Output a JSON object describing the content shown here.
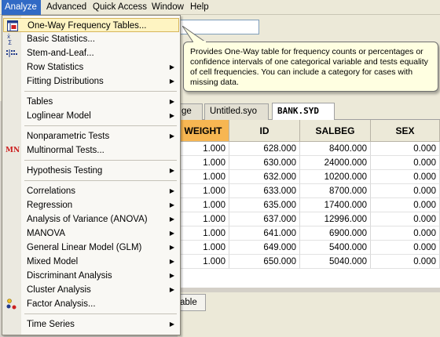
{
  "menubar": {
    "items": [
      "Analyze",
      "Advanced",
      "Quick Access",
      "Window",
      "Help"
    ]
  },
  "tooltip": {
    "text": "Provides One-Way table for frequency counts or percentages or confidence intervals of one categorical variable and tests equality of cell frequencies. You can include a category for cases with missing data."
  },
  "tabs": {
    "partial": "ge",
    "syntax": "Untitled.syo",
    "data": "BANK.SYD"
  },
  "grid": {
    "columns": [
      "WEIGHT",
      "ID",
      "SALBEG",
      "SEX"
    ],
    "rows": [
      [
        "1.000",
        "628.000",
        "8400.000",
        "0.000"
      ],
      [
        "1.000",
        "630.000",
        "24000.000",
        "0.000"
      ],
      [
        "1.000",
        "632.000",
        "10200.000",
        "0.000"
      ],
      [
        "1.000",
        "633.000",
        "8700.000",
        "0.000"
      ],
      [
        "1.000",
        "635.000",
        "17400.000",
        "0.000"
      ],
      [
        "1.000",
        "637.000",
        "12996.000",
        "0.000"
      ],
      [
        "1.000",
        "641.000",
        "6900.000",
        "0.000"
      ],
      [
        "1.000",
        "649.000",
        "5400.000",
        "0.000"
      ],
      [
        "1.000",
        "650.000",
        "5040.000",
        "0.000"
      ]
    ]
  },
  "bottom_tab": "able",
  "menu": {
    "items": [
      {
        "label": "One-Way Frequency Tables...",
        "sub": false
      },
      {
        "label": "Basic Statistics...",
        "sub": false
      },
      {
        "label": "Stem-and-Leaf...",
        "sub": false
      },
      {
        "label": "Row Statistics",
        "sub": true
      },
      {
        "label": "Fitting Distributions",
        "sub": true
      },
      {
        "label": "Tables",
        "sub": true
      },
      {
        "label": "Loglinear Model",
        "sub": true
      },
      {
        "label": "Nonparametric Tests",
        "sub": true
      },
      {
        "label": "Multinormal Tests...",
        "sub": false
      },
      {
        "label": "Hypothesis Testing",
        "sub": true
      },
      {
        "label": "Correlations",
        "sub": true
      },
      {
        "label": "Regression",
        "sub": true
      },
      {
        "label": "Analysis of Variance (ANOVA)",
        "sub": true
      },
      {
        "label": "MANOVA",
        "sub": true
      },
      {
        "label": "General Linear Model (GLM)",
        "sub": true
      },
      {
        "label": "Mixed Model",
        "sub": true
      },
      {
        "label": "Discriminant Analysis",
        "sub": true
      },
      {
        "label": "Cluster Analysis",
        "sub": true
      },
      {
        "label": "Factor Analysis...",
        "sub": false
      },
      {
        "label": "Time Series",
        "sub": true
      }
    ],
    "icons": {
      "one_way": "frequency-table-icon",
      "basic_stats": "basic-statistics-icon",
      "stem_leaf": "stem-and-leaf-icon",
      "multinormal": "MN",
      "factor": "factor-analysis-icon"
    },
    "highlight_color": "#fef4c2",
    "submenu_arrow": "▶"
  }
}
